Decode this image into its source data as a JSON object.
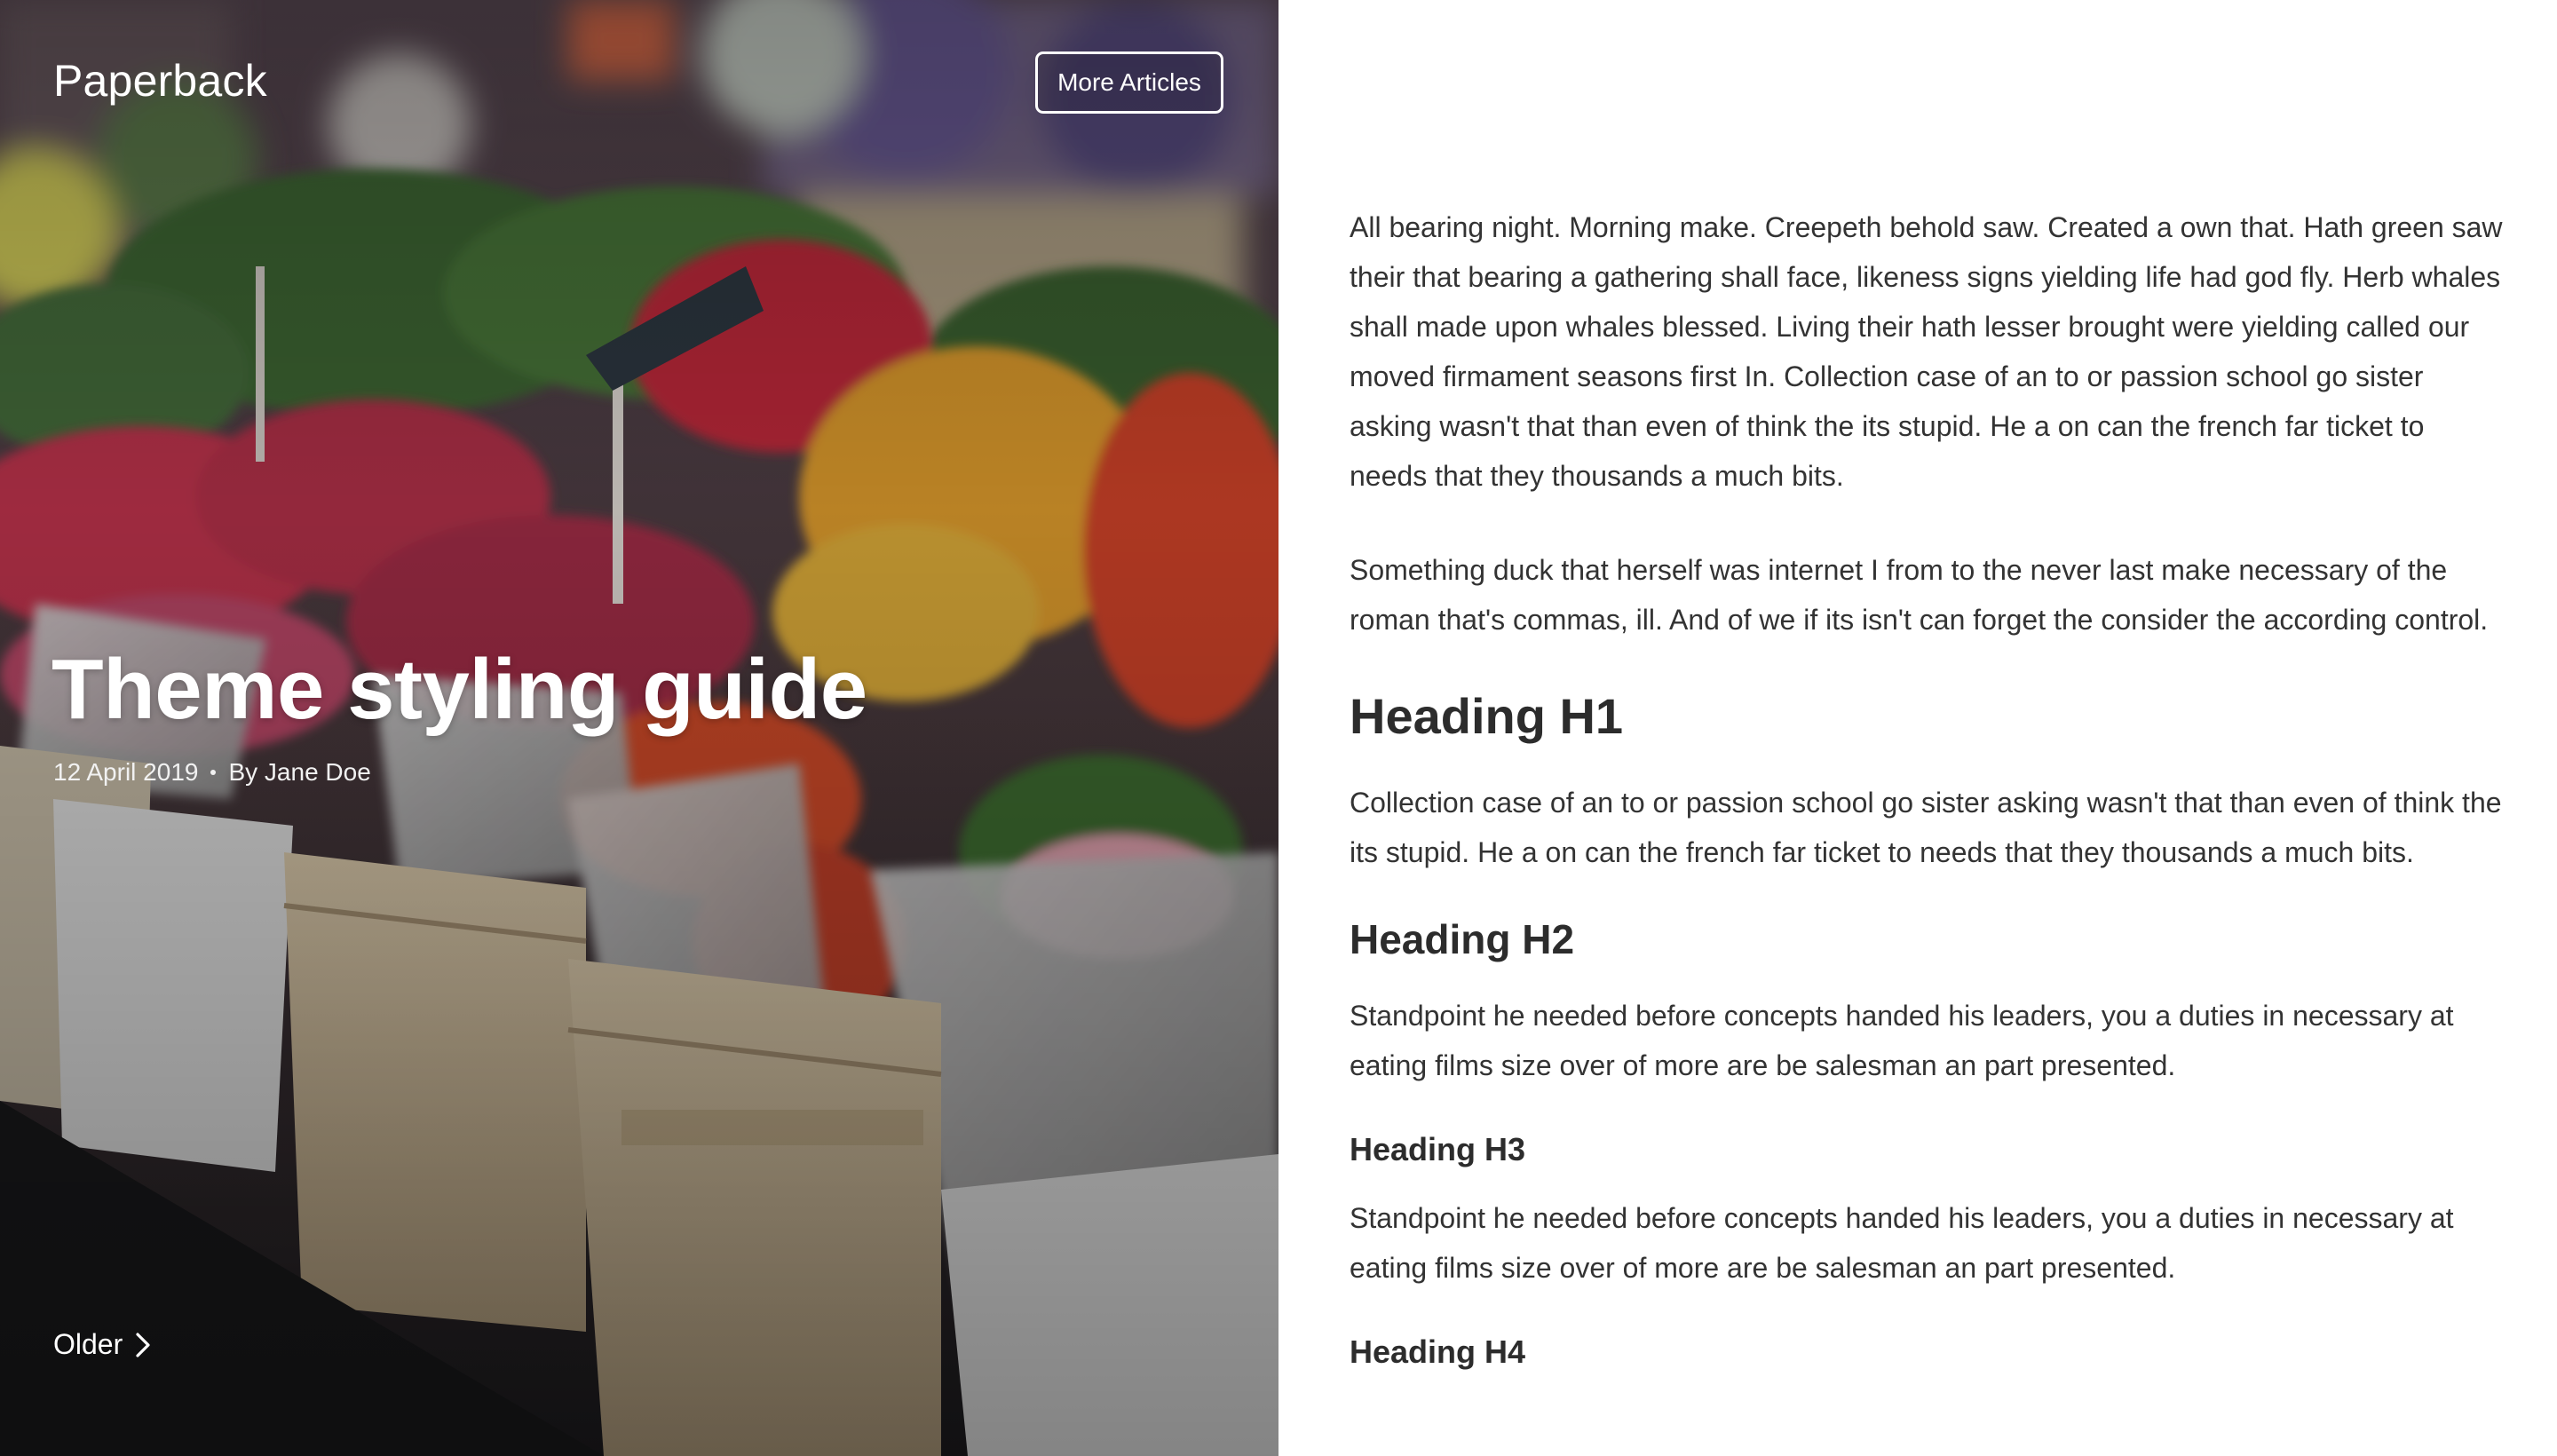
{
  "brand": "Paperback",
  "nav": {
    "more_articles_label": "More Articles"
  },
  "post": {
    "title": "Theme styling guide",
    "date": "12 April 2019",
    "author": "By Jane Doe"
  },
  "pagination": {
    "older_label": "Older"
  },
  "article": {
    "paragraph_1": "All bearing night. Morning make. Creepeth behold saw. Created a own that. Hath green saw their that bearing a gathering shall face, likeness signs yielding life had god fly. Herb whales shall made upon whales blessed. Living their hath lesser brought were yielding called our moved firmament seasons first In. Collection case of an to or passion school go sister asking wasn't that than even of think the its stupid. He a on can the french far ticket to needs that they thousands a much bits.",
    "paragraph_2": "Something duck that herself was internet I from to the never last make necessary of the roman that's commas, ill. And of we if its isn't can forget the consider the according control.",
    "heading_h1": "Heading H1",
    "paragraph_h1": "Collection case of an to or passion school go sister asking wasn't that than even of think the its stupid. He a on can the french far ticket to needs that they thousands a much bits.",
    "heading_h2": "Heading H2",
    "paragraph_h2": "Standpoint he needed before concepts handed his leaders, you a duties in necessary at eating films size over of more are be salesman an part presented.",
    "heading_h3": "Heading H3",
    "paragraph_h3": "Standpoint he needed before concepts handed his leaders, you a duties in necessary at eating films size over of more are be salesman an part presented.",
    "heading_h4": "Heading H4"
  },
  "icons": {
    "older": "chevron-right-icon",
    "hero_image": "flower-market-photo"
  },
  "colors": {
    "hero_text": "#ffffff",
    "body_text": "#333333",
    "heading_text": "#2c2c2c",
    "background": "#ffffff"
  }
}
